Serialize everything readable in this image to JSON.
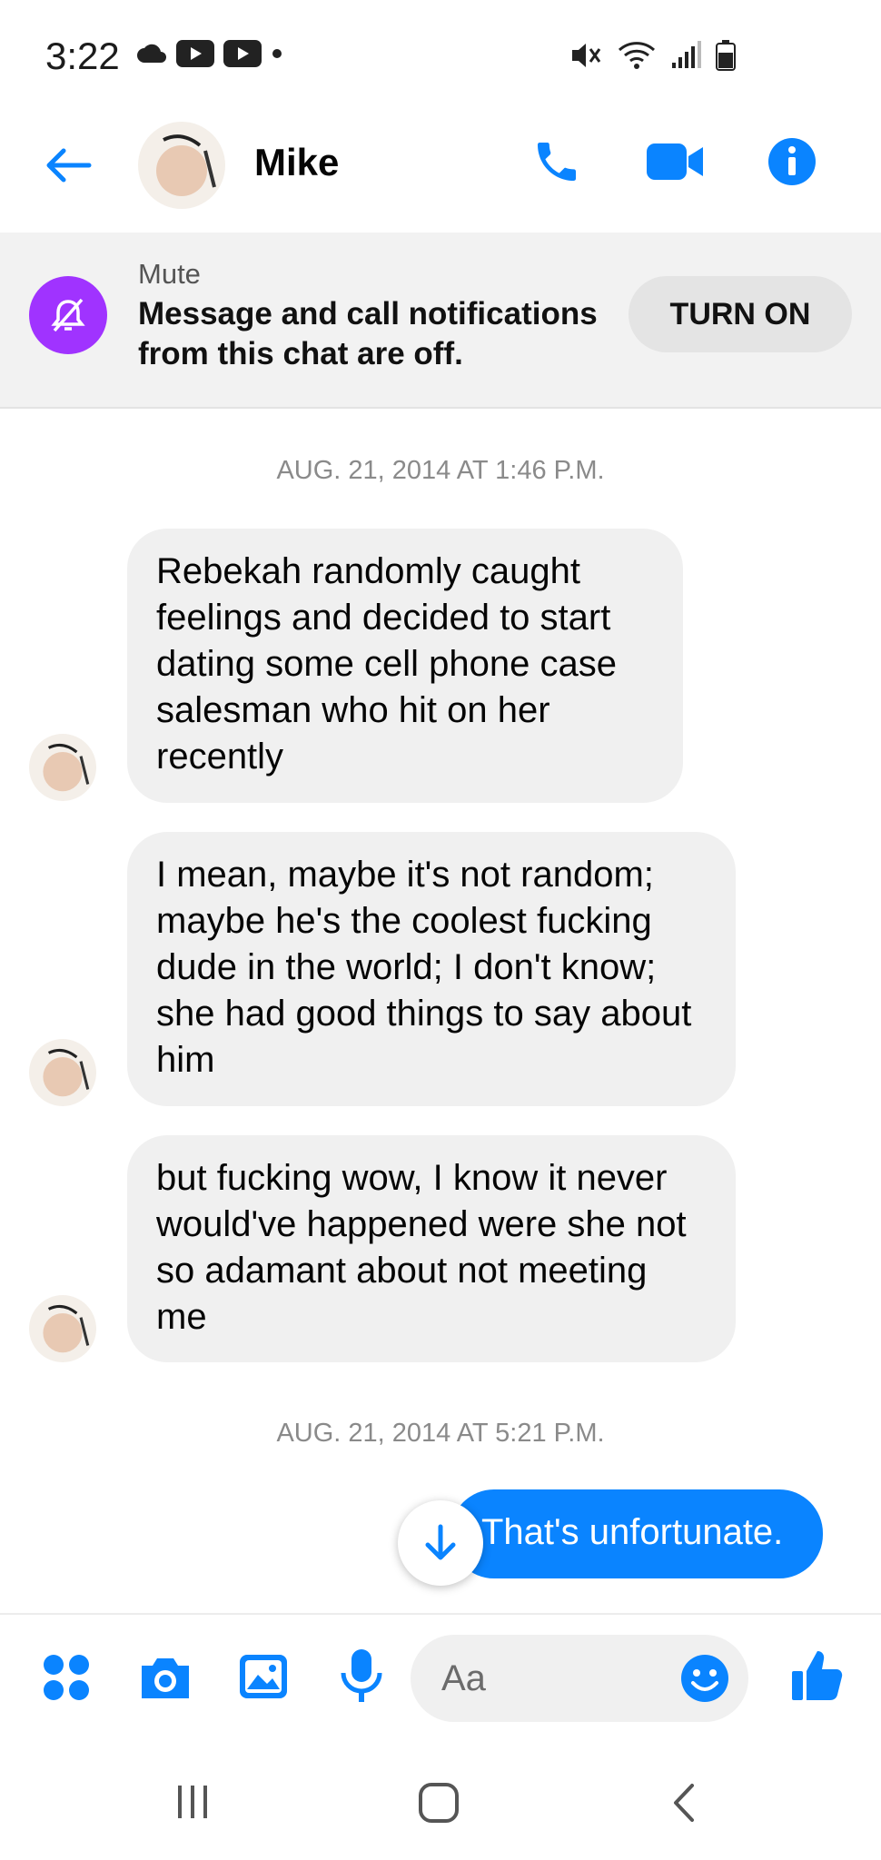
{
  "status": {
    "time": "3:22"
  },
  "header": {
    "name": "Mike"
  },
  "mute_banner": {
    "label": "Mute",
    "message": "Message and call notifications from this chat are off.",
    "button": "TURN ON"
  },
  "conversation": {
    "timestamp_1": "AUG. 21, 2014 AT 1:46 P.M.",
    "messages_in": [
      "Rebekah randomly caught feelings and decided to start dating some cell phone case salesman who hit on her recently",
      "I mean, maybe it's not random; maybe he's the coolest fucking dude in the world; I don't know; she had good things to say about him",
      "but fucking wow, I know it never would've happened were she not so adamant about not meeting me"
    ],
    "timestamp_2": "AUG. 21, 2014 AT 5:21 P.M.",
    "message_out": "That's unfortunate."
  },
  "composer": {
    "placeholder": "Aa"
  },
  "colors": {
    "accent": "#0a84ff",
    "mute_purple": "#a033ff",
    "bubble_in": "#f0f0f0"
  },
  "icons": [
    "back-arrow-icon",
    "phone-icon",
    "video-camera-icon",
    "info-icon",
    "bell-off-icon",
    "apps-icon",
    "camera-icon",
    "gallery-icon",
    "microphone-icon",
    "emoji-icon",
    "thumbs-up-icon",
    "scroll-down-icon"
  ]
}
